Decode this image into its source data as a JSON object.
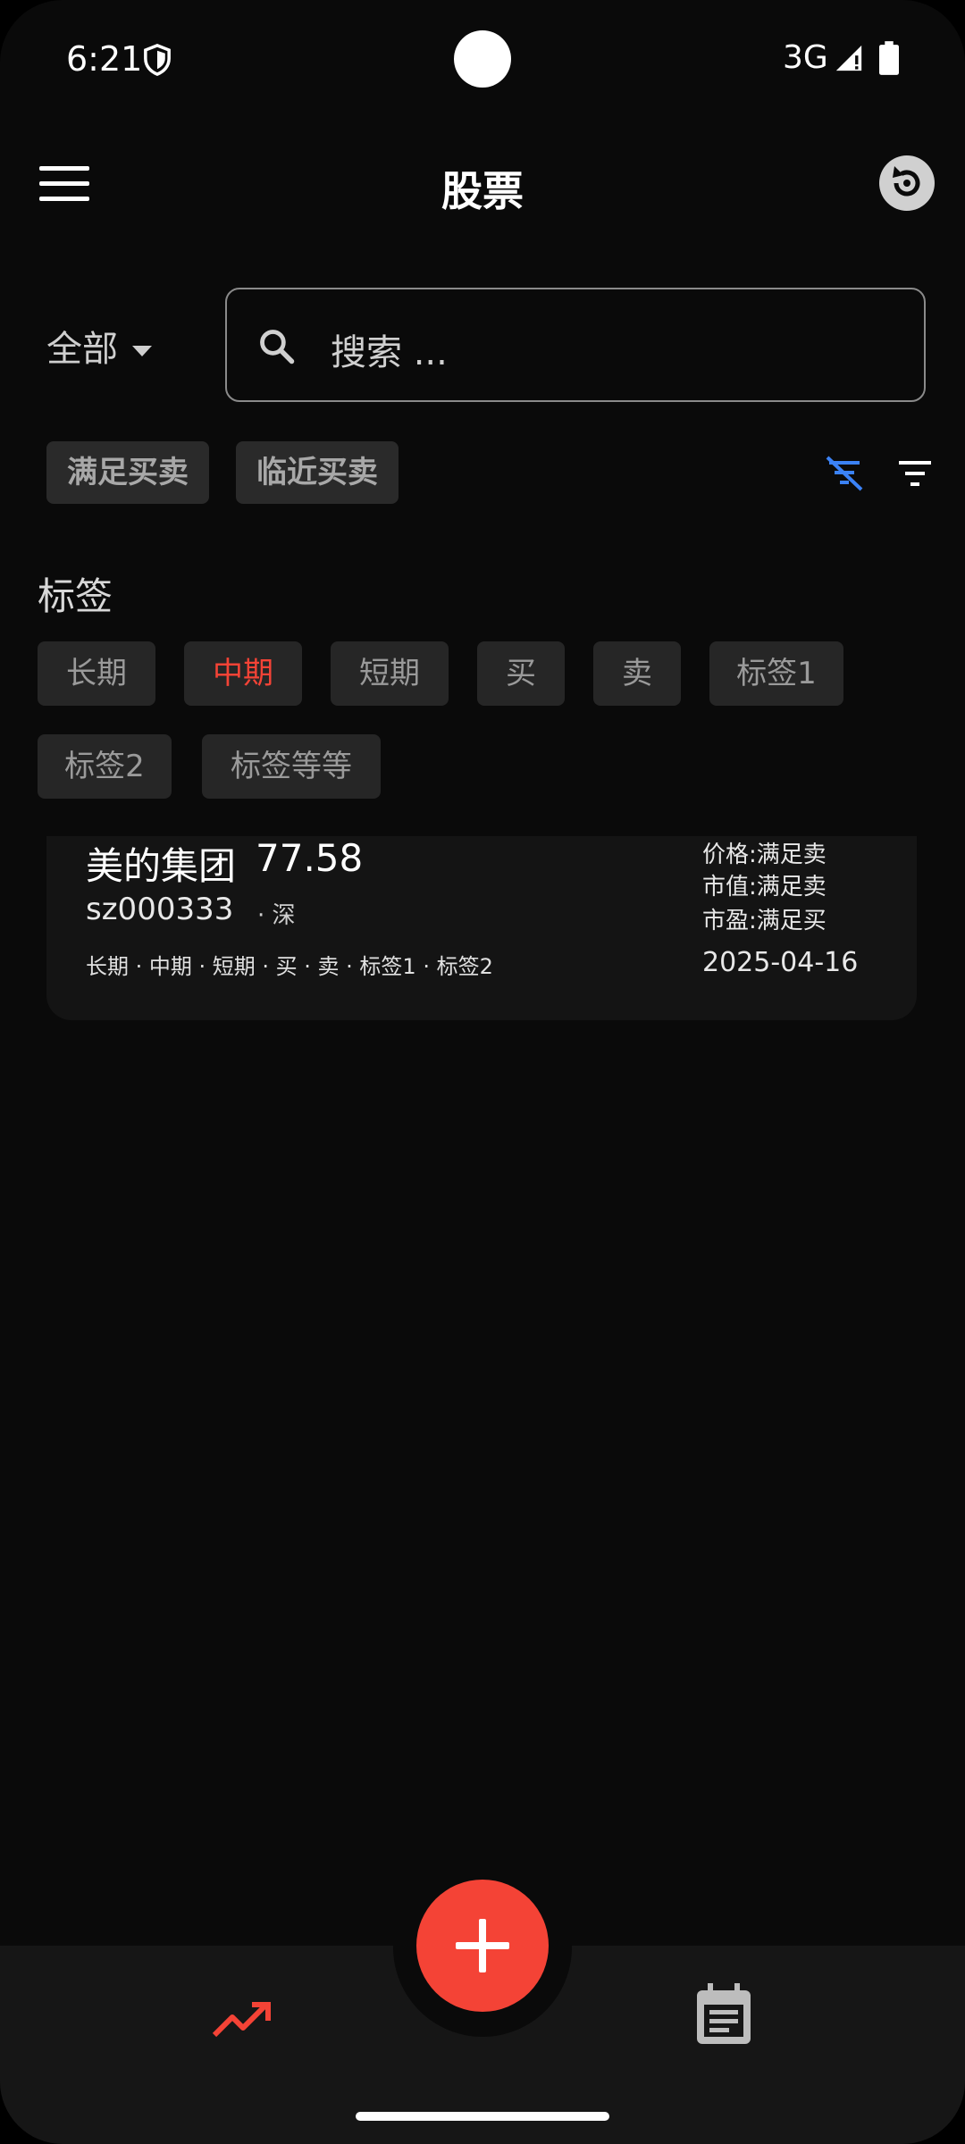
{
  "status_bar": {
    "time": "6:21",
    "network": "3G"
  },
  "app_bar": {
    "title": "股票"
  },
  "scope_dropdown": {
    "value": "全部"
  },
  "search": {
    "placeholder": "搜索 ..."
  },
  "quick_filters": [
    "满足买卖",
    "临近买卖"
  ],
  "tags": {
    "title": "标签",
    "items": [
      {
        "label": "长期",
        "active": false
      },
      {
        "label": "中期",
        "active": true
      },
      {
        "label": "短期",
        "active": false
      },
      {
        "label": "买",
        "active": false
      },
      {
        "label": "卖",
        "active": false
      },
      {
        "label": "标签1",
        "active": false
      },
      {
        "label": "标签2",
        "active": false
      },
      {
        "label": "标签等等",
        "active": false
      }
    ]
  },
  "stocks": [
    {
      "name": "美的集团",
      "price": "77.58",
      "code": "sz000333",
      "market": "· 深",
      "tags_line": "长期 · 中期 · 短期 · 买 · 卖 · 标签1 · 标签2",
      "status": [
        "价格:满足卖",
        "市值:满足卖",
        "市盈:满足买"
      ],
      "date": "2025-04-16"
    }
  ],
  "bottom_nav": [
    {
      "icon": "trending-up-icon",
      "active": true
    },
    {
      "icon": "calendar-icon",
      "active": false
    }
  ],
  "colors": {
    "accent": "#f44336",
    "filter_active": "#3b82f6",
    "background": "#0a0a0a"
  }
}
